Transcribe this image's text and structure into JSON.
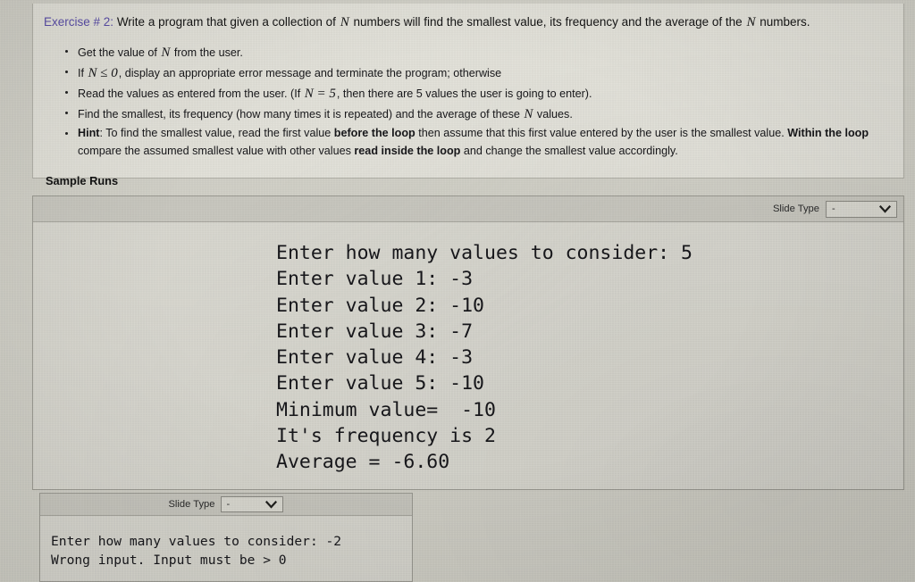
{
  "exercise": {
    "label": "Exercise # 2:",
    "title_parts": [
      "Write a program that given a collection of ",
      "N",
      " numbers will find the smallest value, its frequency and the average of the ",
      "N",
      " numbers."
    ],
    "bullets": [
      {
        "id": "bullet-get-value",
        "segments": [
          {
            "t": "Get the value of ",
            "s": "n"
          },
          {
            "t": "N",
            "s": "v"
          },
          {
            "t": " from the user.",
            "s": "n"
          }
        ]
      },
      {
        "id": "bullet-negative-check",
        "segments": [
          {
            "t": "If ",
            "s": "n"
          },
          {
            "t": "N ≤ 0",
            "s": "v"
          },
          {
            "t": ", display an appropriate error message and terminate the program; otherwise",
            "s": "n"
          }
        ]
      },
      {
        "id": "bullet-read-values",
        "segments": [
          {
            "t": "Read the values as entered from the user. (If ",
            "s": "n"
          },
          {
            "t": "N = 5",
            "s": "v"
          },
          {
            "t": ", then there are 5 values the user is going to enter).",
            "s": "n"
          }
        ]
      },
      {
        "id": "bullet-find-smallest",
        "segments": [
          {
            "t": "Find the smallest, its frequency (how many times it is repeated) and the average of these ",
            "s": "n"
          },
          {
            "t": "N",
            "s": "v"
          },
          {
            "t": " values.",
            "s": "n"
          }
        ]
      },
      {
        "id": "bullet-hint",
        "segments": [
          {
            "t": "Hint",
            "s": "b"
          },
          {
            "t": ": To find the smallest value, read the first value ",
            "s": "n"
          },
          {
            "t": "before the loop",
            "s": "b"
          },
          {
            "t": " then assume that this first value entered by the user is the smallest value. ",
            "s": "n"
          },
          {
            "t": "Within the loop",
            "s": "b"
          },
          {
            "t": " compare the assumed smallest value with other values ",
            "s": "n"
          },
          {
            "t": "read inside the loop",
            "s": "b"
          },
          {
            "t": " and change the smallest value accordingly.",
            "s": "n"
          }
        ]
      }
    ],
    "sample_runs_heading": "Sample Runs"
  },
  "panels": [
    {
      "id": "panel-main",
      "slide_type_label": "Slide Type",
      "slide_type_value": "-",
      "console_text": "Enter how many values to consider: 5\nEnter value 1: -3\nEnter value 2: -10\nEnter value 3: -7\nEnter value 4: -3\nEnter value 5: -10\nMinimum value=  -10\nIt's frequency is 2\nAverage = -6.60"
    },
    {
      "id": "panel-second",
      "slide_type_label": "Slide Type",
      "slide_type_value": "-",
      "console_text": "Enter how many values to consider: -2\nWrong input. Input must be > 0"
    }
  ],
  "colors": {
    "page_background": "#d2d1c8",
    "exercise_box_background": "#e3e2da",
    "panel_background": "#d9d8d0",
    "panel_header_background": "#c9c8c0",
    "exercise_label": "#5b4ea8",
    "body_text": "#17171a"
  },
  "icons": {
    "chevron_down": "chevron-down-icon"
  }
}
